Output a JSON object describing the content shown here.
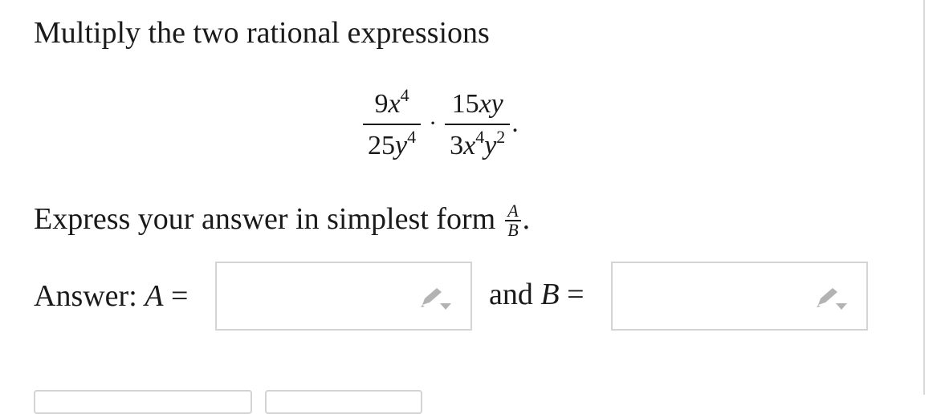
{
  "question": {
    "prompt": "Multiply the two rational expressions"
  },
  "expression": {
    "frac1": {
      "num_coef": "9",
      "num_var": "x",
      "num_exp": "4",
      "den_coef": "25",
      "den_var": "y",
      "den_exp": "4"
    },
    "operator": "·",
    "frac2": {
      "num_coef": "15",
      "num_vars": "xy",
      "den_coef": "3",
      "den_var1": "x",
      "den_exp1": "4",
      "den_var2": "y",
      "den_exp2": "2"
    },
    "trailing": "."
  },
  "instruction": {
    "text": "Express your answer in simplest form",
    "frac_num": "A",
    "frac_den": "B",
    "trailing": "."
  },
  "answer": {
    "prefix": "Answer:",
    "var_a": "A",
    "equals": "=",
    "conjunction": "and",
    "var_b": "B",
    "input_a_value": "",
    "input_b_value": ""
  },
  "icons": {
    "edit_a": "pencil-icon",
    "edit_b": "pencil-icon"
  },
  "colors": {
    "text": "#1a1a1a",
    "input_border": "#d4d4d4",
    "icon": "#b3b3b3"
  }
}
